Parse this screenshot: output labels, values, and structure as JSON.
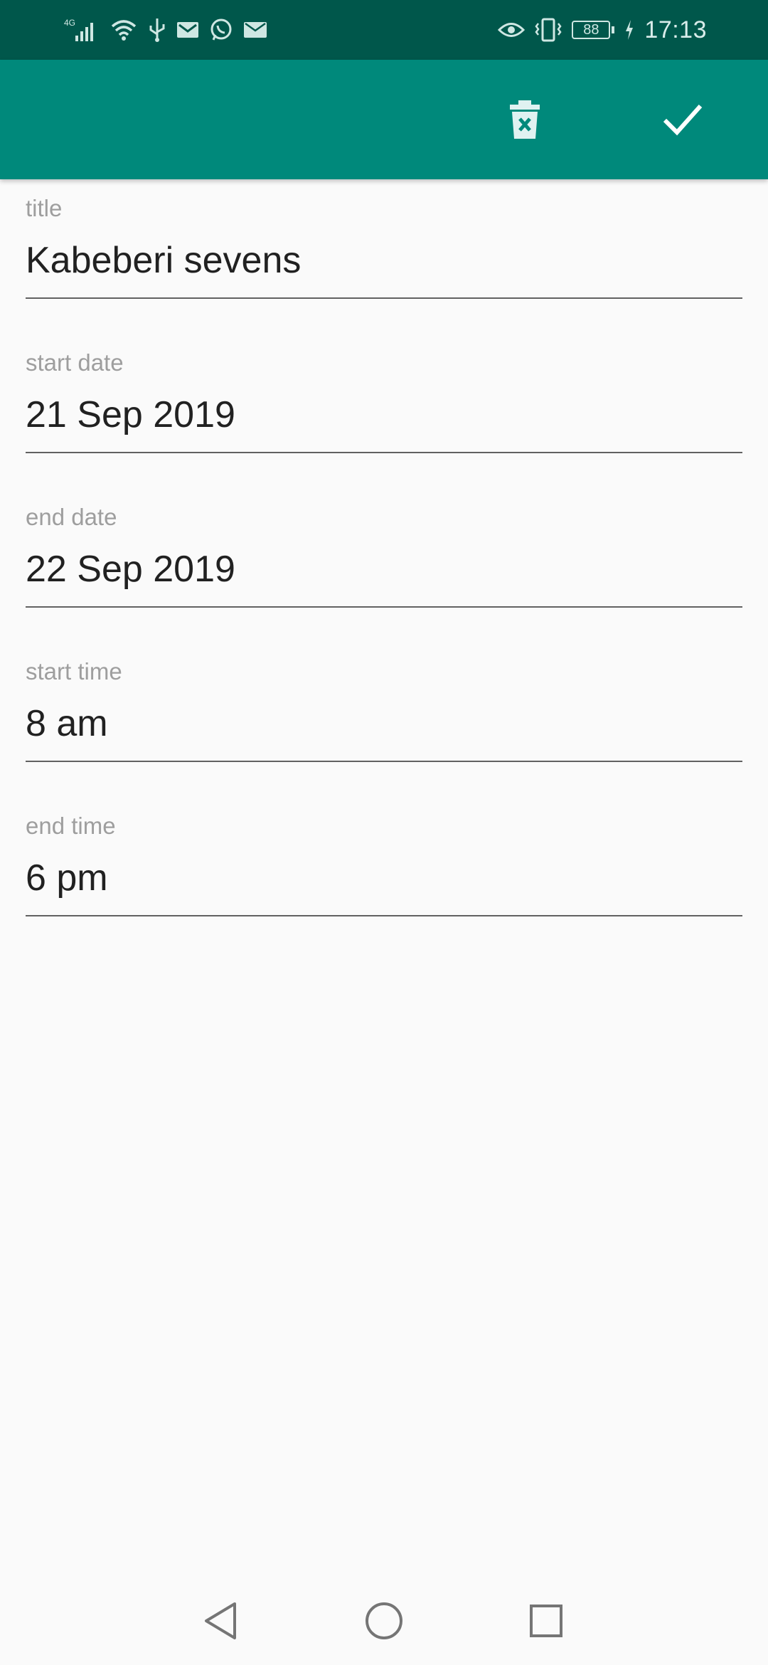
{
  "status_bar": {
    "network_type": "4G",
    "battery_level": "88",
    "time": "17:13",
    "left_icons": [
      "signal-icon",
      "wifi-icon",
      "usb-icon",
      "gmail-icon",
      "whatsapp-icon",
      "mail-icon"
    ],
    "right_icons": [
      "eye-comfort-icon",
      "vibrate-icon",
      "battery-icon",
      "charging-icon"
    ]
  },
  "app_bar": {
    "actions": [
      {
        "icon": "delete-icon"
      },
      {
        "icon": "check-icon"
      }
    ]
  },
  "form": {
    "fields": [
      {
        "label": "title",
        "value": "Kabeberi sevens"
      },
      {
        "label": "start date",
        "value": "21 Sep 2019"
      },
      {
        "label": "end date",
        "value": "22 Sep 2019"
      },
      {
        "label": "start time",
        "value": "8 am"
      },
      {
        "label": "end time",
        "value": "6 pm"
      }
    ]
  },
  "nav_bar": {
    "buttons": [
      "back-icon",
      "home-icon",
      "recents-icon"
    ]
  },
  "colors": {
    "status_bar": "#00574b",
    "app_bar": "#00897b",
    "background": "#fafafa",
    "label": "#9e9e9e",
    "text": "#212121",
    "underline": "#616161"
  }
}
